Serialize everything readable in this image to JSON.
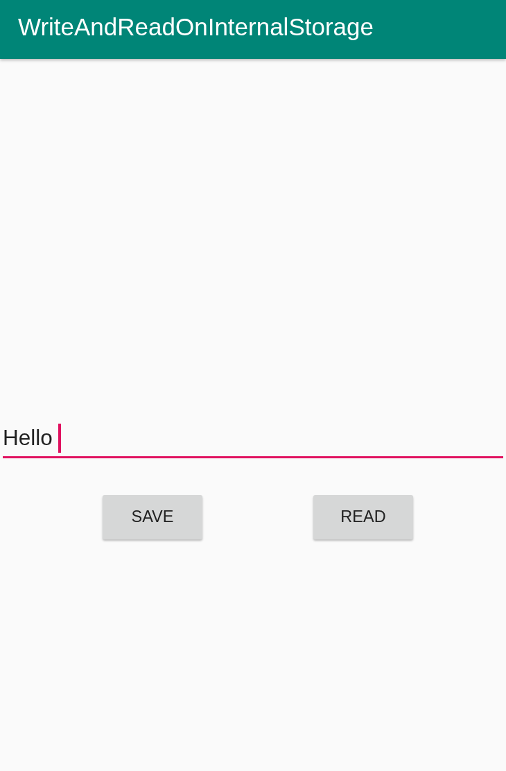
{
  "app_bar": {
    "title": "WriteAndReadOnInternalStorage"
  },
  "text_input": {
    "value": "Hello",
    "focused": true
  },
  "buttons": [
    {
      "label": "SAVE"
    },
    {
      "label": "READ"
    }
  ]
}
